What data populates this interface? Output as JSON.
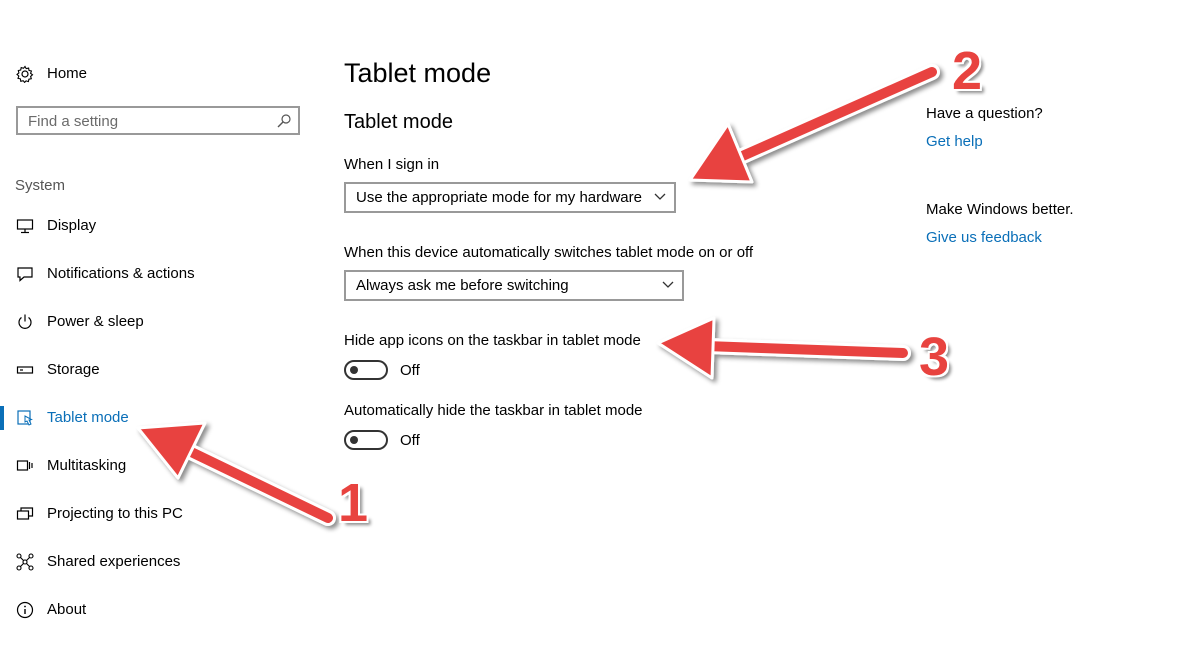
{
  "sidebar": {
    "home_label": "Home",
    "search_placeholder": "Find a setting",
    "section_label": "System",
    "items": [
      {
        "label": "Display",
        "icon": "monitor-icon"
      },
      {
        "label": "Notifications & actions",
        "icon": "message-icon"
      },
      {
        "label": "Power & sleep",
        "icon": "power-icon"
      },
      {
        "label": "Storage",
        "icon": "storage-icon"
      },
      {
        "label": "Tablet mode",
        "icon": "tablet-mode-icon",
        "active": true
      },
      {
        "label": "Multitasking",
        "icon": "multitasking-icon"
      },
      {
        "label": "Projecting to this PC",
        "icon": "projecting-icon"
      },
      {
        "label": "Shared experiences",
        "icon": "shared-icon"
      },
      {
        "label": "About",
        "icon": "info-icon"
      }
    ]
  },
  "main": {
    "page_title": "Tablet mode",
    "section_title": "Tablet mode",
    "signin_label": "When I sign in",
    "signin_value": "Use the appropriate mode for my hardware",
    "switch_label": "When this device automatically switches tablet mode on or off",
    "switch_value": "Always ask me before switching",
    "hide_icons_label": "Hide app icons on the taskbar in tablet mode",
    "hide_icons_state": "Off",
    "hide_taskbar_label": "Automatically hide the taskbar in tablet mode",
    "hide_taskbar_state": "Off"
  },
  "aside": {
    "question": "Have a question?",
    "help_link": "Get help",
    "better": "Make Windows better.",
    "feedback_link": "Give us feedback"
  },
  "annotations": {
    "n1": "1",
    "n2": "2",
    "n3": "3",
    "color": "#e8433f"
  },
  "colors": {
    "accent": "#0a6fb8"
  }
}
